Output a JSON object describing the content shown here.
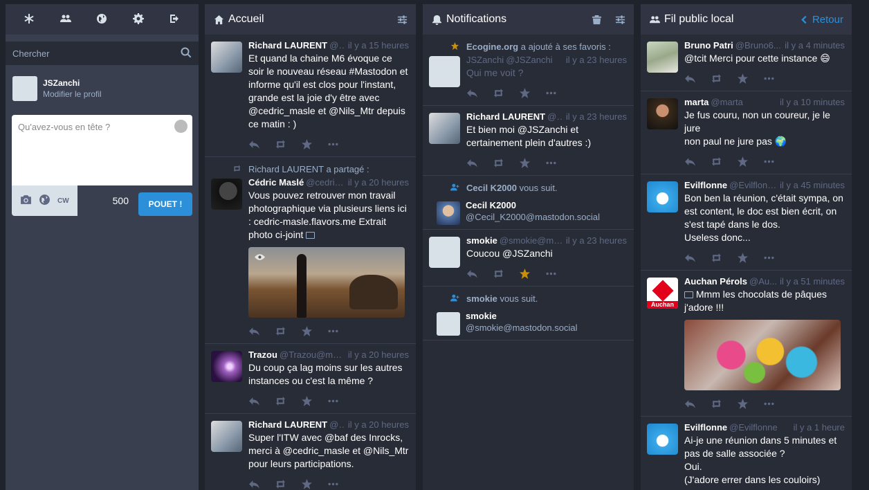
{
  "compose": {
    "search_placeholder": "Chercher",
    "user_name": "JSZanchi",
    "edit_profile": "Modifier le profil",
    "textarea_placeholder": "Qu'avez-vous en tête ?",
    "cw_label": "CW",
    "char_count": "500",
    "toot_label": "POUET !"
  },
  "home": {
    "title": "Accueil",
    "statuses": [
      {
        "name": "Richard LAURENT",
        "acct": "@R...",
        "time": "il y a 15 heures",
        "text": "Et quand la chaine M6 évoque ce soir le nouveau réseau #Mastodon et informe qu'il est clos pour l'instant, grande est la joie d'y être avec @cedric_masle et @Nils_Mtr depuis ce matin : )"
      },
      {
        "prefix": "Richard LAURENT a partagé :",
        "name": "Cédric Maslé",
        "acct": "@cedric...",
        "time": "il y a 20 heures",
        "text": "Vous pouvez retrouver mon travail photographique via plusieurs liens ici : cedric-masle.flavors.me Extrait photo ci-joint"
      },
      {
        "name": "Trazou",
        "acct": "@Trazou@mas...",
        "time": "il y a 20 heures",
        "text": "Du coup ça lag moins sur les autres instances ou c'est la même ?"
      },
      {
        "name": "Richard LAURENT",
        "acct": "@R...",
        "time": "il y a 20 heures",
        "text": "Super l'ITW avec @baf des Inrocks, merci à @cedric_masle et @Nils_Mtr pour leurs participations."
      }
    ]
  },
  "notifications": {
    "title": "Notifications",
    "items": [
      {
        "prefix_user": "Ecogine.org",
        "prefix_text": "a ajouté à ses favoris :",
        "name": "JSZanchi",
        "acct": "@JSZanchi",
        "time": "il y a 23 heures",
        "text": "Qui me voit ?"
      },
      {
        "name": "Richard LAURENT",
        "acct": "@R...",
        "time": "il y a 23 heures",
        "text": "Et bien moi @JSZanchi et certainement plein d'autres :)"
      },
      {
        "prefix_user": "Cecil K2000",
        "prefix_text": "vous suit.",
        "name": "Cecil K2000",
        "acct": "@Cecil_K2000@mastodon.social"
      },
      {
        "name": "smokie",
        "acct": "@smokie@ma...",
        "time": "il y a 23 heures",
        "text": "Coucou @JSZanchi"
      },
      {
        "prefix_user": "smokie",
        "prefix_text": "vous suit.",
        "name": "smokie",
        "acct": "@smokie@mastodon.social"
      }
    ]
  },
  "public": {
    "title": "Fil public local",
    "back_label": "Retour",
    "statuses": [
      {
        "name": "Bruno Patri",
        "acct": "@Bruno6...",
        "time": "il y a 4 minutes",
        "text": "@tcit Merci pour cette instance 😄"
      },
      {
        "name": "marta",
        "acct": "@marta",
        "time": "il y a 10 minutes",
        "text": "Je fus couru, non un coureur, je le jure\nnon paul ne jure pas 🌍"
      },
      {
        "name": "Evilflonne",
        "acct": "@Evilflonne",
        "time": "il y a 45 minutes",
        "text": "Bon ben la réunion, c'était sympa, on est content, le doc est bien écrit, on s'est tapé dans le dos.\nUseless donc..."
      },
      {
        "name": "Auchan Pérols",
        "acct": "@Au...",
        "time": "il y a 51 minutes",
        "text": "Mmm les chocolats de pâques j'adore !!!",
        "avatar_text": "Auchan"
      },
      {
        "name": "Evilflonne",
        "acct": "@Evilflonne",
        "time": "il y a 1 heure",
        "text": "Ai-je une réunion dans 5 minutes et pas de salle associée ?\nOui.\n(J'adore errer dans les couloirs)"
      }
    ]
  },
  "colors": {
    "accent": "#2b90d9",
    "favourite": "#ca8f04",
    "column_bg": "#282c37",
    "header_bg": "#313543"
  },
  "icons": [
    "asterisk-icon",
    "users-icon",
    "globe-icon",
    "gear-icon",
    "sign-out-icon",
    "search-icon",
    "home-icon",
    "bell-icon",
    "trash-icon",
    "sliders-icon",
    "reply-icon",
    "retweet-icon",
    "star-icon",
    "ellipsis-icon",
    "camera-icon",
    "eye-icon",
    "image-icon"
  ]
}
